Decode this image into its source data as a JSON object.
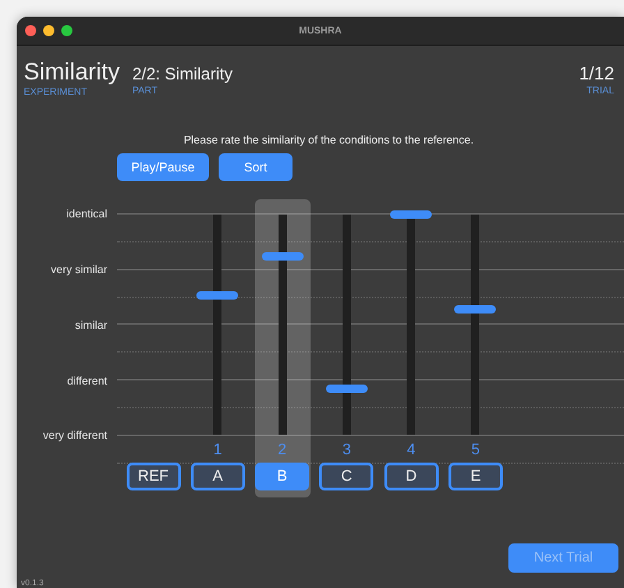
{
  "window": {
    "title": "MUSHRA"
  },
  "header": {
    "experiment": {
      "value": "Similarity",
      "label": "EXPERIMENT"
    },
    "part": {
      "value": "2/2: Similarity",
      "label": "PART"
    },
    "trial": {
      "value": "1/12",
      "label": "TRIAL"
    }
  },
  "instruction": "Please rate the similarity of the conditions to the reference.",
  "buttons": [
    "Play/Pause",
    "Sort"
  ],
  "scale": [
    "identical",
    "very similar",
    "similar",
    "different",
    "very different"
  ],
  "reference": {
    "label": "REF"
  },
  "conditions": [
    {
      "number": "1",
      "label": "A",
      "level": 0.63,
      "selected": false
    },
    {
      "number": "2",
      "label": "B",
      "level": 0.81,
      "selected": true
    },
    {
      "number": "3",
      "label": "C",
      "level": 0.21,
      "selected": false
    },
    {
      "number": "4",
      "label": "D",
      "level": 1.0,
      "selected": false
    },
    {
      "number": "5",
      "label": "E",
      "level": 0.57,
      "selected": false
    }
  ],
  "next_button": {
    "label": "Next Trial",
    "disabled": true
  },
  "version": "v0.1.3"
}
